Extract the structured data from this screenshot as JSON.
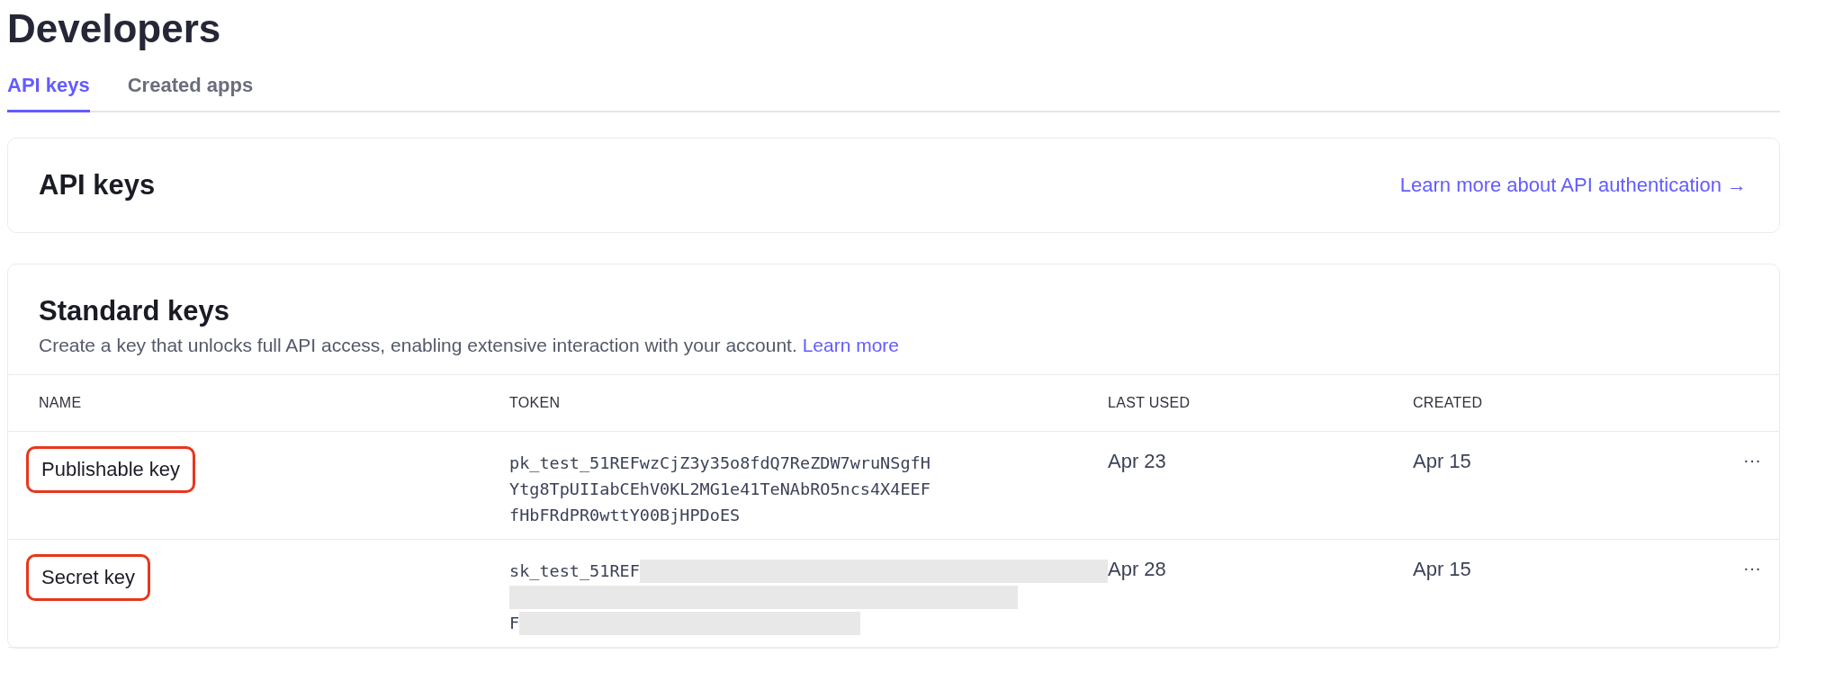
{
  "page_title": "Developers",
  "tabs": [
    {
      "label": "API keys",
      "selected": true
    },
    {
      "label": "Created apps",
      "selected": false
    }
  ],
  "api_keys_card": {
    "title": "API keys",
    "link": "Learn more about API authentication →"
  },
  "standard_keys": {
    "title": "Standard keys",
    "description": "Create a key that unlocks full API access, enabling extensive interaction with your account.",
    "description_link": "Learn more",
    "columns": [
      "NAME",
      "TOKEN",
      "LAST USED",
      "CREATED"
    ],
    "rows": [
      {
        "name": "Publishable key",
        "highlighted": true,
        "token_lines": [
          {
            "text": "pk_test_51REFwzCjZ3y35o8fdQ7ReZDW7wruNSgfH",
            "redacted": false
          },
          {
            "text": "Ytg8TpUIIabCEhV0KL2MG1e41TeNAbRO5ncs4X4EEF",
            "redacted": false
          },
          {
            "text": "fHbFRdPR0wttY00BjHPDoES",
            "redacted": false
          }
        ],
        "last_used": "Apr 23",
        "created": "Apr 15",
        "menu": "···"
      },
      {
        "name": "Secret key",
        "highlighted": true,
        "token_lines": [
          {
            "text": "sk_test_51REF",
            "redacted": true
          },
          {
            "redacted": true
          },
          {
            "text": "F",
            "redacted": true
          }
        ],
        "last_used": "Apr 28",
        "created": "Apr 15",
        "menu": "···"
      }
    ]
  }
}
